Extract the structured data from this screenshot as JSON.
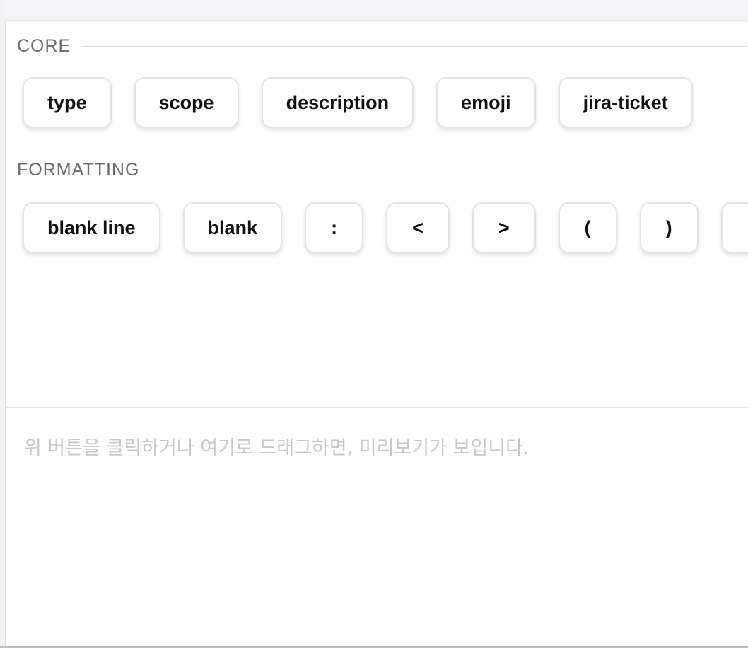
{
  "sections": {
    "core": {
      "title": "CORE",
      "chips": [
        "type",
        "scope",
        "description",
        "emoji",
        "jira-ticket"
      ]
    },
    "formatting": {
      "title": "FORMATTING",
      "chips": [
        "blank line",
        "blank",
        ":",
        "<",
        ">",
        "(",
        ")",
        "["
      ]
    }
  },
  "preview": {
    "placeholder": "위 버튼을 클릭하거나 여기로 드래그하면, 미리보기가 보입니다."
  }
}
